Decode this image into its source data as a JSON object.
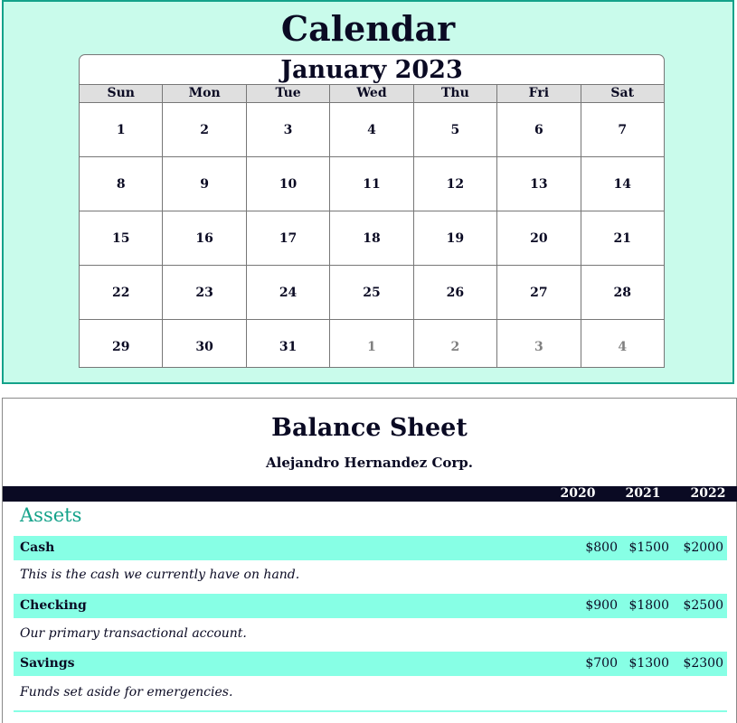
{
  "calendar": {
    "title": "Calendar",
    "month": "January 2023",
    "days_of_week": [
      "Sun",
      "Mon",
      "Tue",
      "Wed",
      "Thu",
      "Fri",
      "Sat"
    ],
    "weeks": [
      [
        {
          "d": "1",
          "m": false
        },
        {
          "d": "2",
          "m": false
        },
        {
          "d": "3",
          "m": false
        },
        {
          "d": "4",
          "m": false
        },
        {
          "d": "5",
          "m": false
        },
        {
          "d": "6",
          "m": false
        },
        {
          "d": "7",
          "m": false
        }
      ],
      [
        {
          "d": "8",
          "m": false
        },
        {
          "d": "9",
          "m": false
        },
        {
          "d": "10",
          "m": false
        },
        {
          "d": "11",
          "m": false
        },
        {
          "d": "12",
          "m": false
        },
        {
          "d": "13",
          "m": false
        },
        {
          "d": "14",
          "m": false
        }
      ],
      [
        {
          "d": "15",
          "m": false
        },
        {
          "d": "16",
          "m": false
        },
        {
          "d": "17",
          "m": false
        },
        {
          "d": "18",
          "m": false
        },
        {
          "d": "19",
          "m": false
        },
        {
          "d": "20",
          "m": false
        },
        {
          "d": "21",
          "m": false
        }
      ],
      [
        {
          "d": "22",
          "m": false
        },
        {
          "d": "23",
          "m": false
        },
        {
          "d": "24",
          "m": false
        },
        {
          "d": "25",
          "m": false
        },
        {
          "d": "26",
          "m": false
        },
        {
          "d": "27",
          "m": false
        },
        {
          "d": "28",
          "m": false
        }
      ],
      [
        {
          "d": "29",
          "m": false
        },
        {
          "d": "30",
          "m": false
        },
        {
          "d": "31",
          "m": false
        },
        {
          "d": "1",
          "m": true
        },
        {
          "d": "2",
          "m": true
        },
        {
          "d": "3",
          "m": true
        },
        {
          "d": "4",
          "m": true
        }
      ]
    ]
  },
  "balance_sheet": {
    "title": "Balance Sheet",
    "company": "Alejandro Hernandez Corp.",
    "years": [
      "2020",
      "2021",
      "2022"
    ],
    "section": "Assets",
    "rows": [
      {
        "label": "Cash",
        "values": [
          "$800",
          "$1500",
          "$2000"
        ],
        "description": "This is the cash we currently have on hand."
      },
      {
        "label": "Checking",
        "values": [
          "$900",
          "$1800",
          "$2500"
        ],
        "description": "Our primary transactional account."
      },
      {
        "label": "Savings",
        "values": [
          "$700",
          "$1300",
          "$2300"
        ],
        "description": "Funds set aside for emergencies."
      }
    ]
  },
  "colors": {
    "panel_bg": "#c9fbeb",
    "accent": "#14a28a",
    "row_highlight": "#87ffe5",
    "dark_bar": "#0a0a23",
    "muted_day": "#808080"
  }
}
